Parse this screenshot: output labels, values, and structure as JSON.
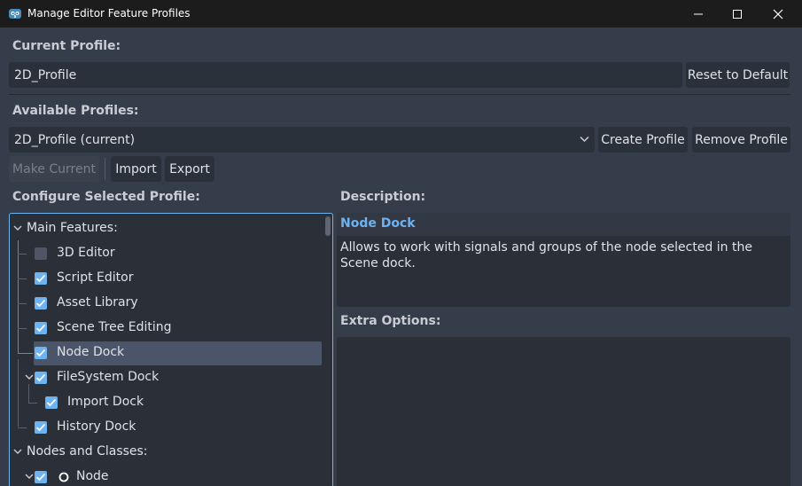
{
  "window": {
    "title": "Manage Editor Feature Profiles"
  },
  "current_profile": {
    "label": "Current Profile:",
    "value": "2D_Profile",
    "reset_button": "Reset to Default"
  },
  "available_profiles": {
    "label": "Available Profiles:",
    "selected": "2D_Profile (current)",
    "create_button": "Create Profile",
    "remove_button": "Remove Profile",
    "make_current_button": "Make Current",
    "import_button": "Import",
    "export_button": "Export"
  },
  "configure": {
    "label": "Configure Selected Profile:",
    "tree": {
      "main_features": "Main Features:",
      "items": [
        {
          "label": "3D Editor",
          "checked": false
        },
        {
          "label": "Script Editor",
          "checked": true
        },
        {
          "label": "Asset Library",
          "checked": true
        },
        {
          "label": "Scene Tree Editing",
          "checked": true
        },
        {
          "label": "Node Dock",
          "checked": true,
          "selected": true
        },
        {
          "label": "FileSystem Dock",
          "checked": true
        },
        {
          "label": "Import Dock",
          "checked": true
        },
        {
          "label": "History Dock",
          "checked": true
        }
      ],
      "nodes_and_classes": "Nodes and Classes:",
      "node": {
        "label": "Node",
        "checked": true
      }
    }
  },
  "description": {
    "label": "Description:",
    "title": "Node Dock",
    "text": "Allows to work with signals and groups of the node selected in the Scene dock."
  },
  "extra_options": {
    "label": "Extra Options:"
  },
  "colors": {
    "accent": "#6fb2f0",
    "background": "#363d4a",
    "panel": "#2a2f38",
    "titlebar": "#1c1c1c"
  }
}
